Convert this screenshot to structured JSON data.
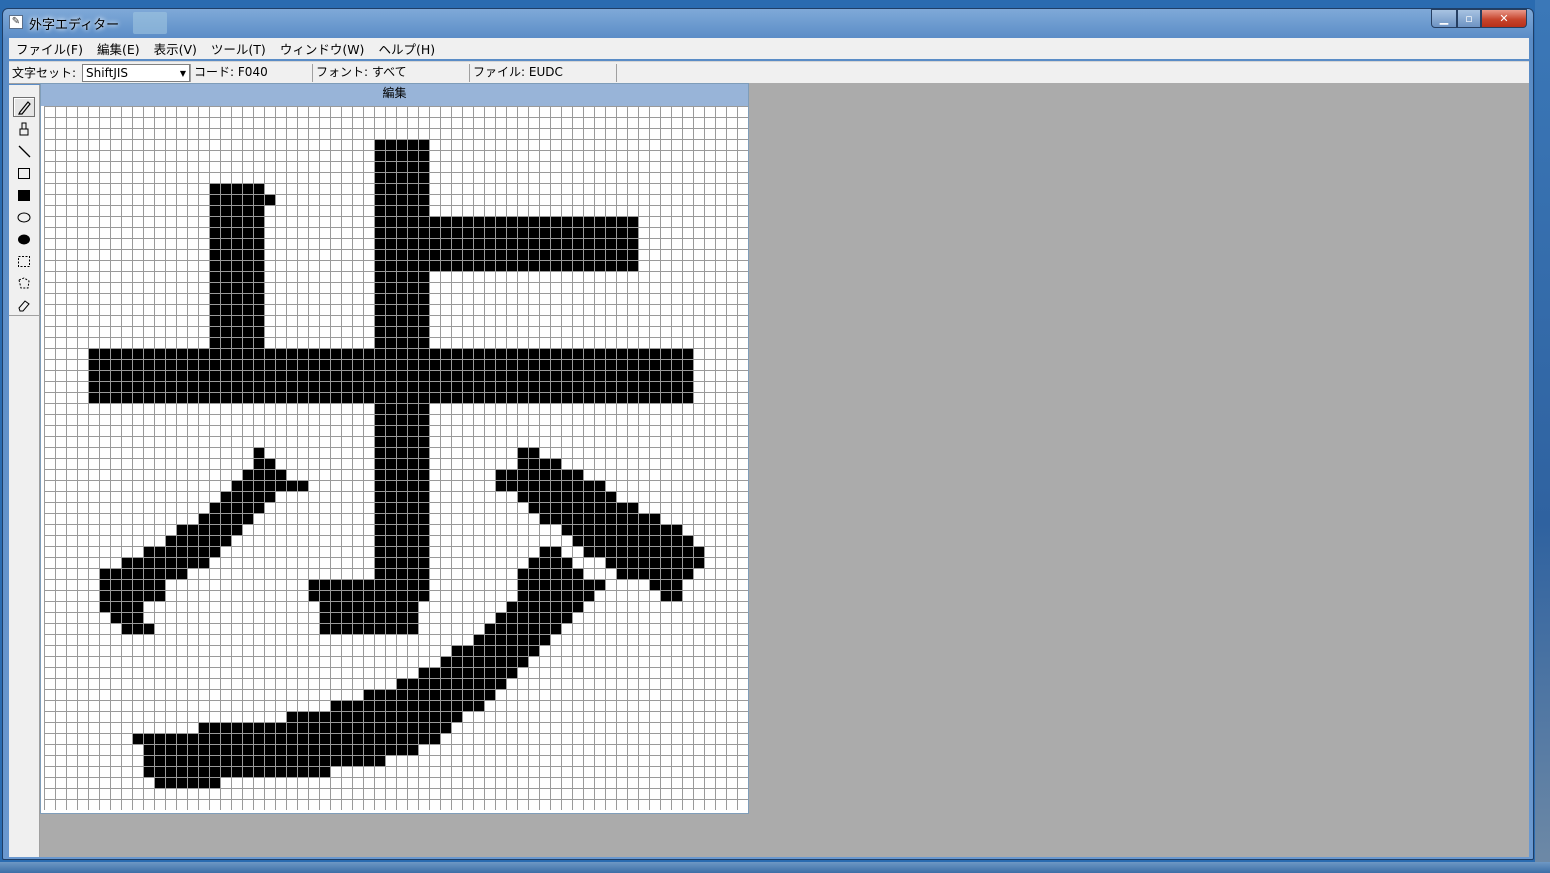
{
  "window": {
    "title": "外字エディター"
  },
  "menu": {
    "items": [
      "ファイル(F)",
      "編集(E)",
      "表示(V)",
      "ツール(T)",
      "ウィンドウ(W)",
      "ヘルプ(H)"
    ]
  },
  "toolbar": {
    "charset_label": "文字セット:",
    "charset_value": "ShiftJIS",
    "code": "コード: F040",
    "font": "フォント: すべて",
    "file": "ファイル: EUDC"
  },
  "tools": [
    "pencil-icon",
    "brush-icon",
    "line-icon",
    "rectangle-outline-icon",
    "rectangle-filled-icon",
    "ellipse-outline-icon",
    "ellipse-filled-icon",
    "rect-select-icon",
    "freeform-select-icon",
    "eraser-icon"
  ],
  "edit_window": {
    "caption": "編集",
    "grid_size": 64,
    "glyph_char": "歩",
    "filled_cells": [
      [
        3,
        30,
        34
      ],
      [
        4,
        30,
        34
      ],
      [
        5,
        30,
        34
      ],
      [
        6,
        30,
        34
      ],
      [
        7,
        15,
        19
      ],
      [
        7,
        30,
        34
      ],
      [
        8,
        15,
        20
      ],
      [
        8,
        30,
        34
      ],
      [
        9,
        15,
        19
      ],
      [
        9,
        30,
        34
      ],
      [
        10,
        15,
        19
      ],
      [
        10,
        30,
        53
      ],
      [
        11,
        15,
        19
      ],
      [
        11,
        30,
        53
      ],
      [
        12,
        15,
        19
      ],
      [
        12,
        30,
        53
      ],
      [
        13,
        15,
        19
      ],
      [
        13,
        30,
        53
      ],
      [
        14,
        15,
        19
      ],
      [
        14,
        30,
        53
      ],
      [
        15,
        15,
        19
      ],
      [
        15,
        30,
        34
      ],
      [
        16,
        15,
        19
      ],
      [
        16,
        30,
        34
      ],
      [
        17,
        15,
        19
      ],
      [
        17,
        30,
        34
      ],
      [
        18,
        15,
        19
      ],
      [
        18,
        30,
        34
      ],
      [
        19,
        15,
        19
      ],
      [
        19,
        30,
        34
      ],
      [
        20,
        15,
        19
      ],
      [
        20,
        30,
        34
      ],
      [
        21,
        15,
        19
      ],
      [
        21,
        30,
        34
      ],
      [
        22,
        4,
        58
      ],
      [
        23,
        4,
        58
      ],
      [
        24,
        4,
        58
      ],
      [
        25,
        4,
        58
      ],
      [
        26,
        4,
        58
      ],
      [
        27,
        30,
        34
      ],
      [
        28,
        30,
        34
      ],
      [
        29,
        30,
        34
      ],
      [
        30,
        30,
        34
      ],
      [
        31,
        19,
        19
      ],
      [
        31,
        30,
        34
      ],
      [
        31,
        43,
        44
      ],
      [
        32,
        19,
        20
      ],
      [
        32,
        30,
        34
      ],
      [
        32,
        43,
        46
      ],
      [
        33,
        18,
        21
      ],
      [
        33,
        30,
        34
      ],
      [
        33,
        41,
        48
      ],
      [
        34,
        17,
        23
      ],
      [
        34,
        30,
        34
      ],
      [
        34,
        41,
        50
      ],
      [
        35,
        16,
        20
      ],
      [
        35,
        30,
        34
      ],
      [
        35,
        43,
        51
      ],
      [
        36,
        15,
        19
      ],
      [
        36,
        30,
        34
      ],
      [
        36,
        44,
        53
      ],
      [
        37,
        14,
        18
      ],
      [
        37,
        30,
        34
      ],
      [
        37,
        45,
        55
      ],
      [
        38,
        12,
        17
      ],
      [
        38,
        30,
        34
      ],
      [
        38,
        47,
        57
      ],
      [
        39,
        11,
        16
      ],
      [
        39,
        30,
        34
      ],
      [
        39,
        48,
        58
      ],
      [
        40,
        9,
        15
      ],
      [
        40,
        30,
        34
      ],
      [
        40,
        45,
        46
      ],
      [
        40,
        49,
        59
      ],
      [
        41,
        7,
        14
      ],
      [
        41,
        30,
        34
      ],
      [
        41,
        44,
        47
      ],
      [
        41,
        51,
        59
      ],
      [
        42,
        5,
        12
      ],
      [
        42,
        30,
        34
      ],
      [
        42,
        43,
        48
      ],
      [
        42,
        52,
        58
      ],
      [
        43,
        5,
        10
      ],
      [
        43,
        24,
        34
      ],
      [
        43,
        43,
        50
      ],
      [
        43,
        55,
        57
      ],
      [
        44,
        5,
        10
      ],
      [
        44,
        24,
        34
      ],
      [
        44,
        43,
        49
      ],
      [
        44,
        56,
        57
      ],
      [
        45,
        5,
        8
      ],
      [
        45,
        25,
        33
      ],
      [
        45,
        42,
        48
      ],
      [
        46,
        6,
        8
      ],
      [
        46,
        25,
        33
      ],
      [
        46,
        41,
        47
      ],
      [
        47,
        7,
        9
      ],
      [
        47,
        25,
        33
      ],
      [
        47,
        40,
        46
      ],
      [
        48,
        39,
        45
      ],
      [
        49,
        37,
        44
      ],
      [
        50,
        36,
        43
      ],
      [
        51,
        34,
        42
      ],
      [
        52,
        32,
        41
      ],
      [
        53,
        29,
        40
      ],
      [
        54,
        26,
        39
      ],
      [
        55,
        22,
        37
      ],
      [
        56,
        14,
        36
      ],
      [
        57,
        8,
        35
      ],
      [
        58,
        9,
        33
      ],
      [
        59,
        9,
        30
      ],
      [
        60,
        9,
        25
      ],
      [
        61,
        10,
        15
      ]
    ]
  }
}
